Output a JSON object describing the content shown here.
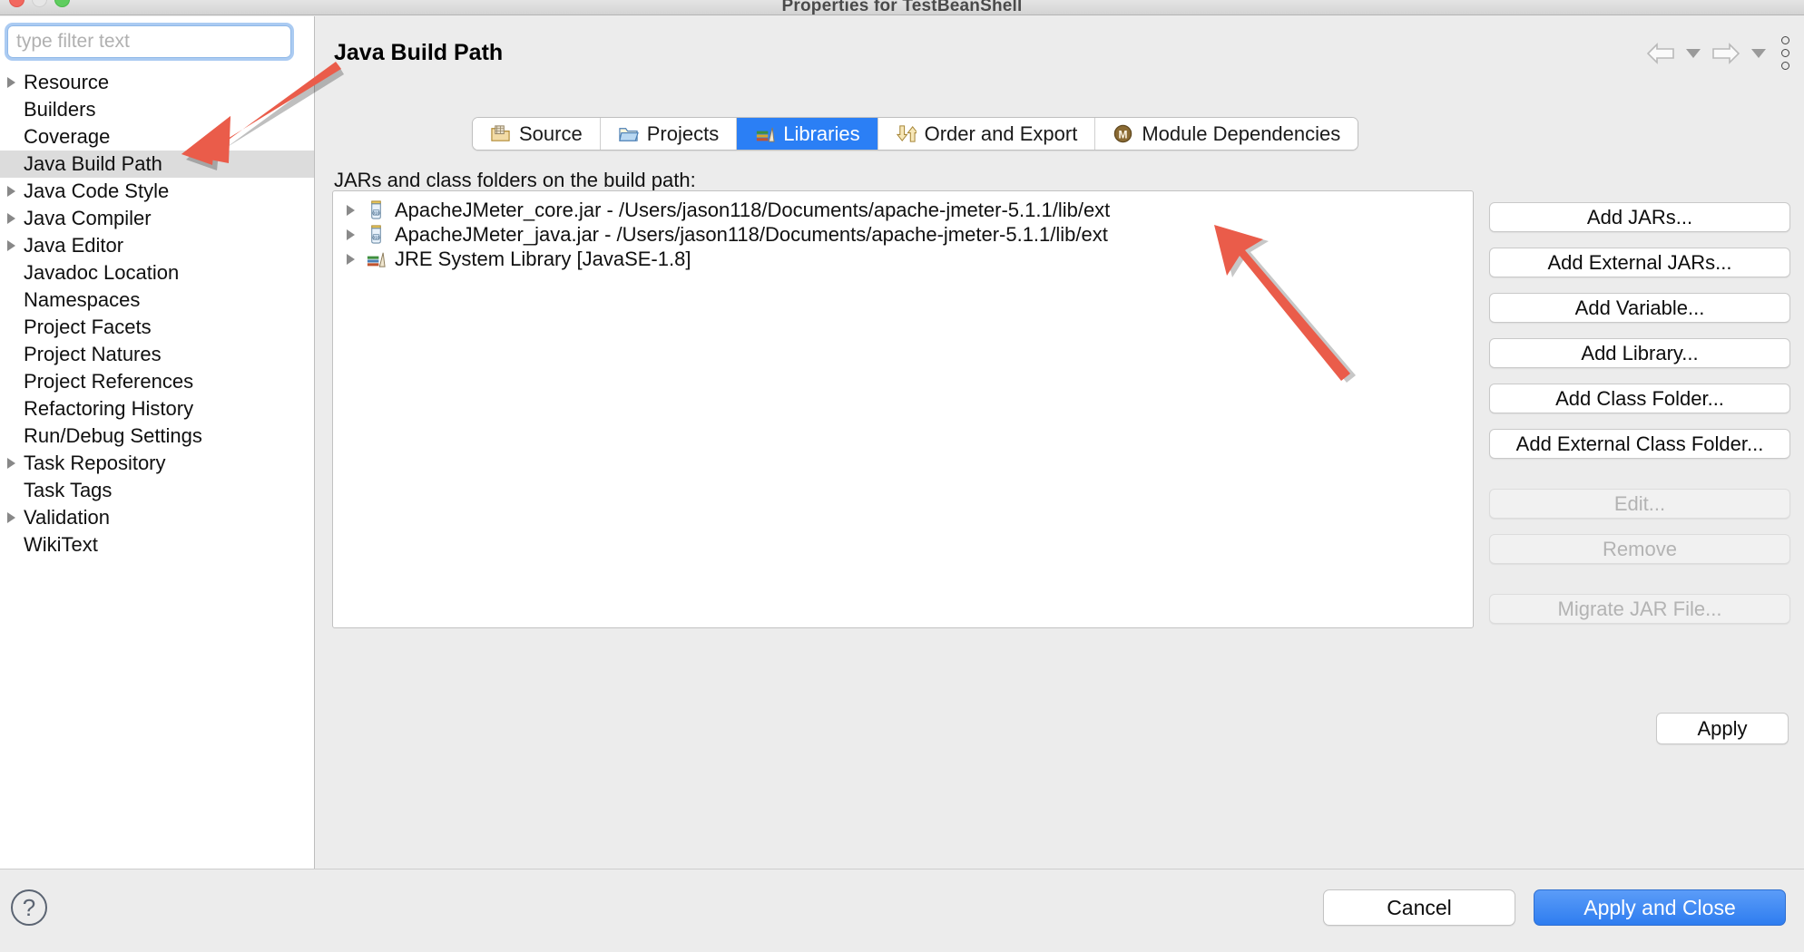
{
  "window": {
    "title": "Properties for TestBeanShell",
    "traffic_lights": [
      "close-button",
      "minimize-button",
      "zoom-button"
    ]
  },
  "sidebar": {
    "filter": {
      "placeholder": "type filter text",
      "value": ""
    },
    "items": [
      {
        "label": "Resource",
        "expandable": true,
        "selected": false
      },
      {
        "label": "Builders",
        "expandable": false,
        "selected": false
      },
      {
        "label": "Coverage",
        "expandable": false,
        "selected": false
      },
      {
        "label": "Java Build Path",
        "expandable": false,
        "selected": true
      },
      {
        "label": "Java Code Style",
        "expandable": true,
        "selected": false
      },
      {
        "label": "Java Compiler",
        "expandable": true,
        "selected": false
      },
      {
        "label": "Java Editor",
        "expandable": true,
        "selected": false
      },
      {
        "label": "Javadoc Location",
        "expandable": false,
        "selected": false
      },
      {
        "label": "Namespaces",
        "expandable": false,
        "selected": false
      },
      {
        "label": "Project Facets",
        "expandable": false,
        "selected": false
      },
      {
        "label": "Project Natures",
        "expandable": false,
        "selected": false
      },
      {
        "label": "Project References",
        "expandable": false,
        "selected": false
      },
      {
        "label": "Refactoring History",
        "expandable": false,
        "selected": false
      },
      {
        "label": "Run/Debug Settings",
        "expandable": false,
        "selected": false
      },
      {
        "label": "Task Repository",
        "expandable": true,
        "selected": false
      },
      {
        "label": "Task Tags",
        "expandable": false,
        "selected": false
      },
      {
        "label": "Validation",
        "expandable": true,
        "selected": false
      },
      {
        "label": "WikiText",
        "expandable": false,
        "selected": false
      }
    ]
  },
  "header": {
    "page_title": "Java Build Path",
    "nav": {
      "back_icon": "back-arrow-icon",
      "back_dropdown_icon": "chevron-down-icon",
      "forward_icon": "forward-arrow-icon",
      "forward_dropdown_icon": "chevron-down-icon",
      "menu_icon": "kebab-menu-icon"
    }
  },
  "tabs": [
    {
      "label": "Source",
      "icon": "source-folder-icon",
      "active": false
    },
    {
      "label": "Projects",
      "icon": "projects-icon",
      "active": false
    },
    {
      "label": "Libraries",
      "icon": "libraries-icon",
      "active": true
    },
    {
      "label": "Order and Export",
      "icon": "order-export-icon",
      "active": false
    },
    {
      "label": "Module Dependencies",
      "icon": "module-icon",
      "active": false
    }
  ],
  "main": {
    "list_label": "JARs and class folders on the build path:",
    "entries": [
      {
        "label": "ApacheJMeter_core.jar - /Users/jason118/Documents/apache-jmeter-5.1.1/lib/ext",
        "icon": "jar-icon",
        "expandable": true
      },
      {
        "label": "ApacheJMeter_java.jar - /Users/jason118/Documents/apache-jmeter-5.1.1/lib/ext",
        "icon": "jar-icon",
        "expandable": true
      },
      {
        "label": "JRE System Library [JavaSE-1.8]",
        "icon": "jre-library-icon",
        "expandable": true
      }
    ]
  },
  "side_buttons": [
    {
      "label": "Add JARs...",
      "enabled": true
    },
    {
      "label": "Add External JARs...",
      "enabled": true
    },
    {
      "label": "Add Variable...",
      "enabled": true
    },
    {
      "label": "Add Library...",
      "enabled": true
    },
    {
      "label": "Add Class Folder...",
      "enabled": true
    },
    {
      "label": "Add External Class Folder...",
      "enabled": true
    },
    {
      "label": "Edit...",
      "enabled": false
    },
    {
      "label": "Remove",
      "enabled": false
    },
    {
      "label": "Migrate JAR File...",
      "enabled": false
    }
  ],
  "footer": {
    "help_label": "?",
    "apply_label": "Apply",
    "cancel_label": "Cancel",
    "apply_close_label": "Apply and Close"
  },
  "annotations": [
    {
      "name": "arrow-pointing-to-java-build-path",
      "color": "#ea5c4a"
    },
    {
      "name": "arrow-pointing-to-jar-entry",
      "color": "#ea5c4a"
    }
  ],
  "colors": {
    "accent_blue": "#2b7ff5",
    "selection_gray": "#dcdcdc",
    "annotation_red": "#ea5c4a",
    "window_bg": "#ececec"
  }
}
